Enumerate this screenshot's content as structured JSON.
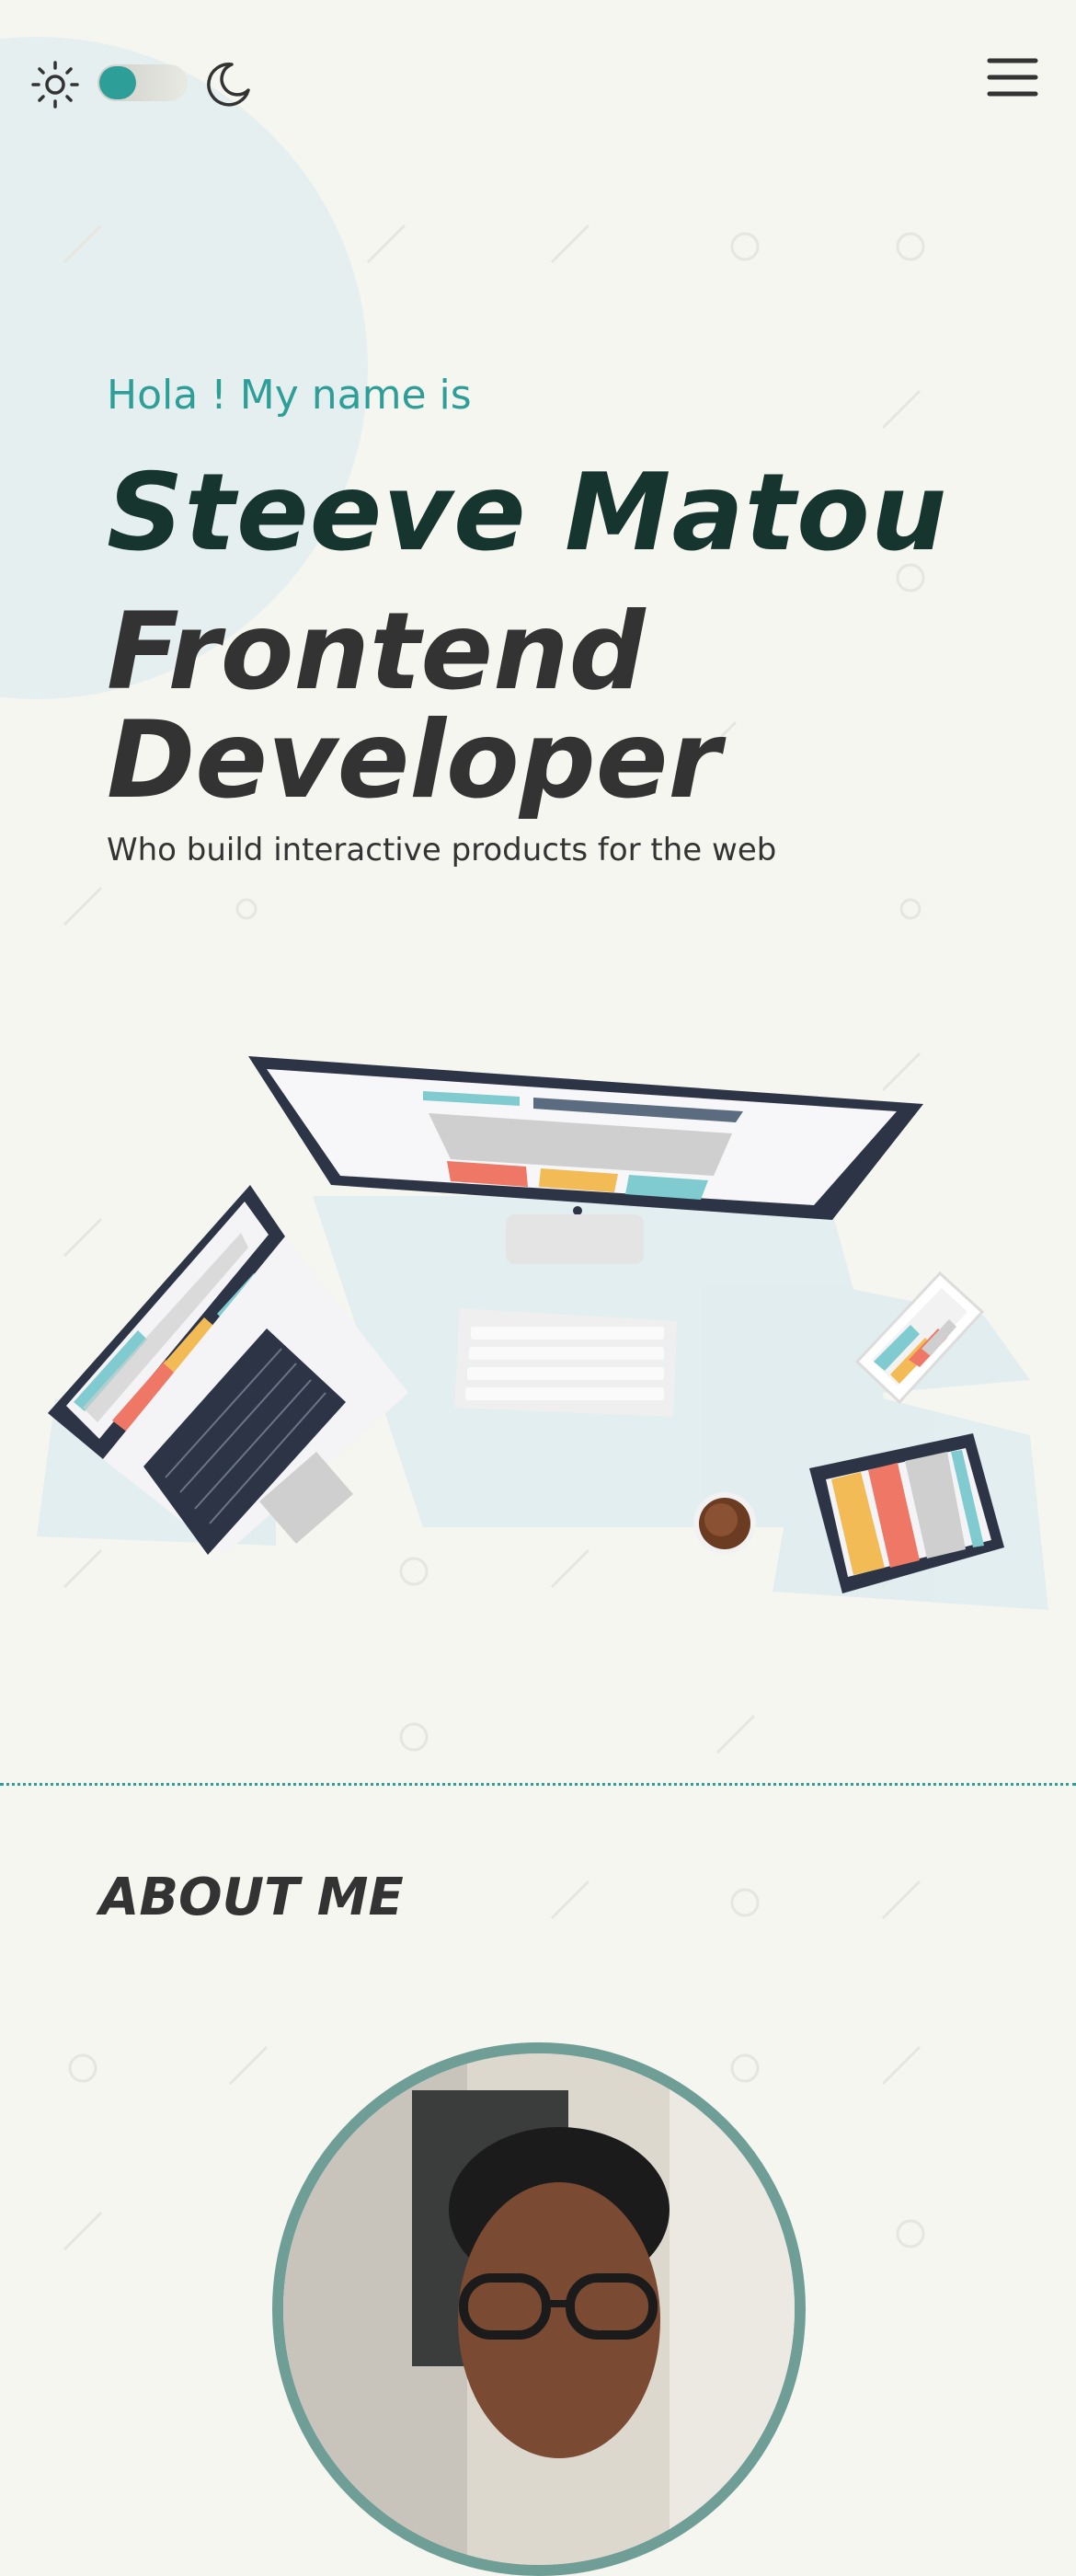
{
  "header": {
    "theme_toggle_state": "light",
    "icons": [
      "sun-icon",
      "moon-icon",
      "menu-icon"
    ]
  },
  "hero": {
    "greeting": "Hola ! My name is",
    "name": "Steeve Matou",
    "role_line1": "Frontend",
    "role_line2": "Developer",
    "tagline": "Who build interactive products for the web"
  },
  "about": {
    "heading": "ABOUT ME"
  },
  "colors": {
    "background": "#f6f6f1",
    "accent": "#2e9e99",
    "name": "#16352e",
    "text": "#333333",
    "avatar_ring": "#6e9e96"
  }
}
